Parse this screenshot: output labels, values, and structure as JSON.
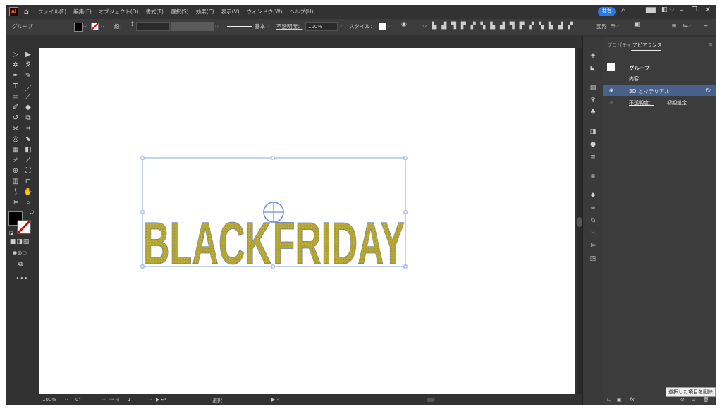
{
  "menu": {
    "app_logo": "Ai",
    "items": [
      "ファイル(F)",
      "編集(E)",
      "オブジェクト(O)",
      "書式(T)",
      "選択(S)",
      "効果(C)",
      "表示(V)",
      "ウィンドウ(W)",
      "ヘルプ(H)"
    ],
    "share_label": "共有"
  },
  "control": {
    "selection_label": "グループ",
    "stroke_label": "線：",
    "stroke_profile": "基本",
    "opacity_label": "不透明度：",
    "opacity_value": "100%",
    "style_label": "スタイル：",
    "transform_label": "変形"
  },
  "panel": {
    "tabs": [
      "プロパティ",
      "アピアランス"
    ],
    "active_tab": "アピアランス",
    "title": "グループ",
    "contents_label": "内容",
    "effect_label": "3D とマテリアル",
    "effect_fx": "fx",
    "opacity_label": "不透明度：",
    "opacity_value": "初期設定"
  },
  "artwork": {
    "text": "BLACKFRIDAY",
    "fill_color": "#b5a532",
    "stroke_color": "#6a7fa6"
  },
  "status": {
    "zoom": "100%",
    "rotation": "0°",
    "artboard_number": "1",
    "tool_name": "選択"
  },
  "tooltip": "選択した項目を削除",
  "colors": {
    "ui_dark": "#323232",
    "ui_panel": "#3c3c3c",
    "accent": "#2b78e4",
    "selection": "#6b8ee6",
    "highlight_row": "#45618c"
  }
}
